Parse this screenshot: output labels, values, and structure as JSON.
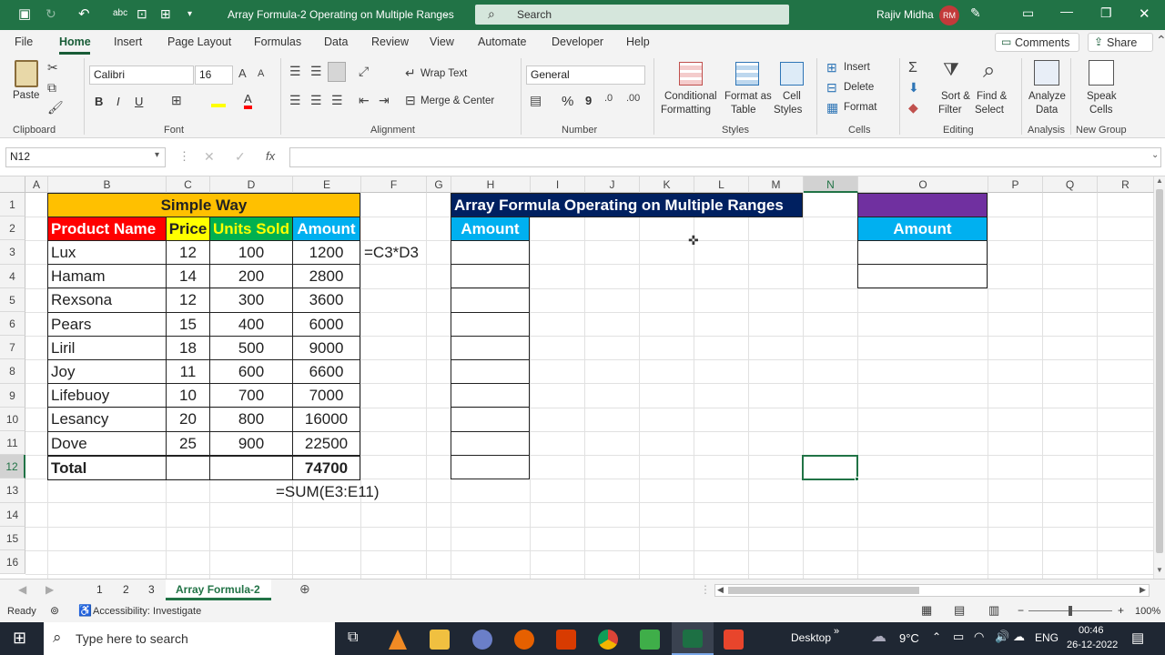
{
  "title_bar": {
    "autosave_icon": "save-icon",
    "workbook_title": "Array Formula-2 Operating on Multiple Ranges",
    "search_placeholder": "Search",
    "user_name": "Rajiv Midha",
    "user_initials": "RM"
  },
  "menu": [
    "File",
    "Home",
    "Insert",
    "Page Layout",
    "Formulas",
    "Data",
    "Review",
    "View",
    "Automate",
    "Developer",
    "Help"
  ],
  "menu_right": {
    "comments": "Comments",
    "share": "Share"
  },
  "ribbon": {
    "clipboard": {
      "paste": "Paste",
      "group": "Clipboard"
    },
    "font": {
      "name": "Calibri",
      "size": "16",
      "group": "Font",
      "bold": "B",
      "italic": "I",
      "underline": "U"
    },
    "alignment": {
      "wrap": "Wrap Text",
      "merge": "Merge & Center",
      "group": "Alignment"
    },
    "number": {
      "format": "General",
      "group": "Number",
      "percent": "%",
      "comma": "9"
    },
    "styles": {
      "conditional_1": "Conditional",
      "conditional_2": "Formatting",
      "format_table_1": "Format as",
      "format_table_2": "Table",
      "cell_styles_1": "Cell",
      "cell_styles_2": "Styles",
      "group": "Styles"
    },
    "cells": {
      "insert": "Insert",
      "delete": "Delete",
      "format": "Format",
      "group": "Cells"
    },
    "editing": {
      "sort_1": "Sort &",
      "sort_2": "Filter",
      "find_1": "Find &",
      "find_2": "Select",
      "group": "Editing"
    },
    "analysis": {
      "analyze_1": "Analyze",
      "analyze_2": "Data",
      "group": "Analysis"
    },
    "newgroup": {
      "speak_1": "Speak",
      "speak_2": "Cells",
      "group": "New Group"
    }
  },
  "formula_bar": {
    "name_box": "N12",
    "fx": "fx",
    "formula": ""
  },
  "columns": [
    "A",
    "B",
    "C",
    "D",
    "E",
    "F",
    "G",
    "H",
    "I",
    "J",
    "K",
    "L",
    "M",
    "N",
    "O",
    "P",
    "Q",
    "R"
  ],
  "rows": [
    "1",
    "2",
    "3",
    "4",
    "5",
    "6",
    "7",
    "8",
    "9",
    "10",
    "11",
    "12",
    "13",
    "14",
    "15",
    "16"
  ],
  "simple_way": {
    "title": "Simple Way",
    "headers": [
      "Product Name",
      "Price",
      "Units Sold",
      "Amount"
    ],
    "rows": [
      [
        "Lux",
        "12",
        "100",
        "1200"
      ],
      [
        "Hamam",
        "14",
        "200",
        "2800"
      ],
      [
        "Rexsona",
        "12",
        "300",
        "3600"
      ],
      [
        "Pears",
        "15",
        "400",
        "6000"
      ],
      [
        "Liril",
        "18",
        "500",
        "9000"
      ],
      [
        "Joy",
        "11",
        "600",
        "6600"
      ],
      [
        "Lifebuoy",
        "10",
        "700",
        "7000"
      ],
      [
        "Lesancy",
        "20",
        "800",
        "16000"
      ],
      [
        "Dove",
        "25",
        "900",
        "22500"
      ]
    ],
    "total_label": "Total",
    "total_value": "74700",
    "formula_row": "=C3*D3",
    "formula_sum": "=SUM(E3:E11)"
  },
  "array_section": {
    "title": "Array Formula Operating on Multiple Ranges",
    "amount_header": "Amount",
    "right_header": "Amount"
  },
  "sheet_tabs": [
    "1",
    "2",
    "3",
    "Array Formula-2"
  ],
  "status": {
    "ready": "Ready",
    "accessibility": "Accessibility: Investigate",
    "zoom": "100%"
  },
  "taskbar": {
    "search_placeholder": "Type here to search",
    "desktop": "Desktop",
    "temperature": "9°C",
    "language": "ENG",
    "time": "00:46",
    "date": "26-12-2022"
  },
  "colors": {
    "excel_green": "#217346",
    "yellow": "#ffc000",
    "red": "#ff0000",
    "blue": "#00b0f0",
    "navy": "#002060",
    "purple": "#7030a0",
    "title_yellow": "#ffc000"
  }
}
